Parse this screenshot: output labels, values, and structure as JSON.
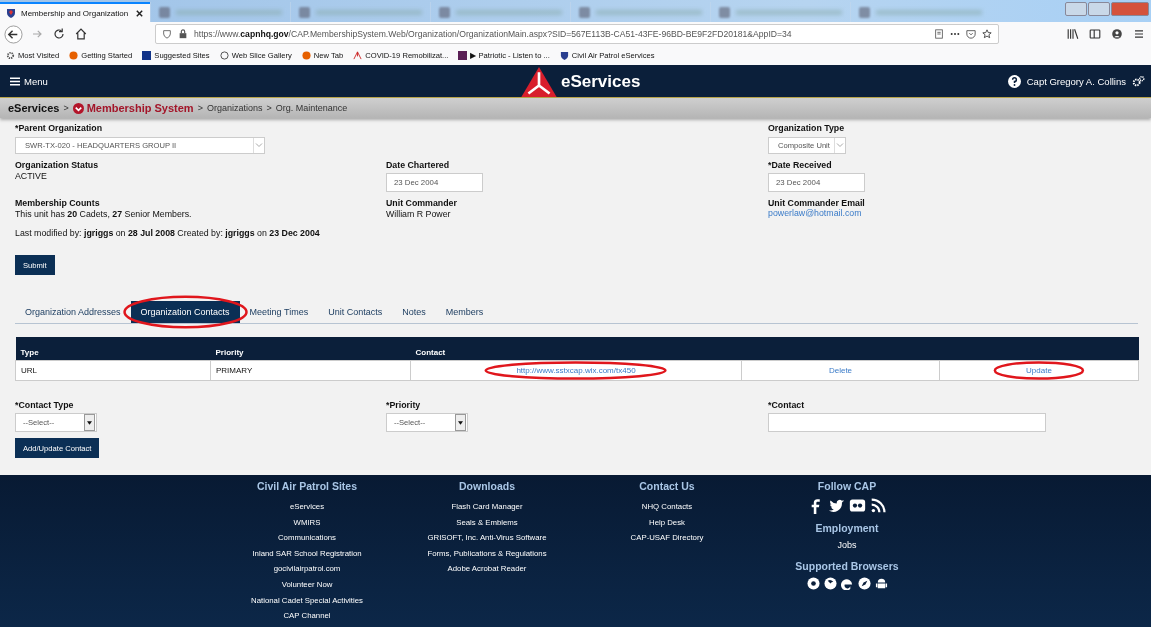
{
  "browser": {
    "tabs": [
      {
        "kind": "page",
        "title": "Membership and Organization",
        "selected": true
      },
      {
        "kind": "blurred",
        "selected": false
      },
      {
        "kind": "blurred",
        "selected": false
      },
      {
        "kind": "blurred",
        "selected": false
      },
      {
        "kind": "blurred",
        "selected": false
      },
      {
        "kind": "blurred",
        "selected": false
      },
      {
        "kind": "blurred",
        "selected": false
      }
    ],
    "url": "https://www.**capnhq.gov**/CAP.MembershipSystem.Web/Organization/OrganizationMain.aspx?SID=567E113B-CA51-43FE-96BD-BE9F2FD20181&AppID=34",
    "bookmarks": [
      {
        "kind": "gear",
        "label": "Most Visited"
      },
      {
        "kind": "firefox",
        "label": "Getting Started"
      },
      {
        "kind": "bing",
        "label": "Suggested Sites"
      },
      {
        "kind": "globe",
        "label": "Web Slice Gallery"
      },
      {
        "kind": "firefox",
        "label": "New Tab"
      },
      {
        "kind": "cap",
        "label": "COVID-19 Remobilizat..."
      },
      {
        "kind": "app",
        "label": "▶ Patriotic - Listen to ..."
      },
      {
        "kind": "shield",
        "label": "Civil Air Patrol eServices"
      }
    ]
  },
  "header": {
    "menu": "Menu",
    "title": "eServices",
    "user": "Capt Gregory A. Collins"
  },
  "breadcrumb": {
    "separator": ">",
    "items": [
      "eServices",
      "Membership System",
      "Organizations",
      "Org. Maintenance"
    ]
  },
  "form_rows": [
    {
      "left": {
        "kind": "select",
        "label": "*Parent Organization",
        "value": "SWR-TX-020 - HEADQUARTERS GROUP II"
      },
      "right": {
        "kind": "select",
        "label": "Organization Type",
        "value": "Composite Unit"
      }
    },
    {
      "left": {
        "kind": "text",
        "label": "Organization Status",
        "value": "ACTIVE"
      },
      "middle": {
        "kind": "input",
        "label": "Date Chartered",
        "value": "23 Dec 2004"
      },
      "right": {
        "kind": "input",
        "label": "*Date Received",
        "value": "23 Dec 2004"
      }
    },
    {
      "left": {
        "kind": "text",
        "label": "Membership Counts",
        "value": "This unit has **20** Cadets,  **27** Senior Members."
      },
      "middle": {
        "kind": "text",
        "label": "Unit Commander",
        "value": "William R Power"
      },
      "right": {
        "kind": "link",
        "label": "Unit Commander Email",
        "value": "powerlaw@hotmail.com"
      }
    }
  ],
  "modified": "Last modified by: **jgriggs** on **28 Jul 2008**    Created by: **jgriggs** on **23 Dec 2004**",
  "submit": "Submit",
  "tabs": [
    {
      "label": "Organization Addresses",
      "selected": false,
      "circled": false
    },
    {
      "label": "Organization Contacts",
      "selected": true,
      "circled": true
    },
    {
      "label": "Meeting Times",
      "selected": false,
      "circled": false
    },
    {
      "label": "Unit Contacts",
      "selected": false,
      "circled": false
    },
    {
      "label": "Notes",
      "selected": false,
      "circled": false
    },
    {
      "label": "Members",
      "selected": false,
      "circled": false
    }
  ],
  "table": {
    "columns": [
      "Type",
      "Priority",
      "Contact"
    ],
    "rows": [
      {
        "type": "URL",
        "priority": "PRIMARY",
        "contact": "http://www.sstxcap.wix.com/tx450",
        "contact_circled": true,
        "delete": "Delete",
        "update": "Update",
        "update_circled": true
      }
    ]
  },
  "contact_form": [
    {
      "kind": "select",
      "label": "*Contact Type",
      "value": "--Select--"
    },
    {
      "kind": "select",
      "label": "*Priority",
      "value": "--Select--"
    },
    {
      "kind": "input",
      "label": "*Contact"
    }
  ],
  "add_button": "Add/Update Contact",
  "footer": {
    "columns": [
      {
        "title": "Civil Air Patrol Sites",
        "links": [
          "eServices",
          "WMIRS",
          "Communications",
          "Inland SAR School Registration",
          "gocivilairpatrol.com",
          "Volunteer Now",
          "National Cadet Special Activities",
          "CAP Channel"
        ]
      },
      {
        "title": "Downloads",
        "links": [
          "Flash Card Manager",
          "Seals & Emblems",
          "GRISOFT, Inc. Anti-Virus Software",
          "Forms, Publications & Regulations",
          "Adobe Acrobat Reader"
        ]
      },
      {
        "title": "Contact Us",
        "links": [
          "NHQ Contacts",
          "Help Desk",
          "CAP-USAF Directory"
        ]
      }
    ],
    "follow": {
      "title": "Follow CAP",
      "icons": [
        {
          "kind": "facebook"
        },
        {
          "kind": "twitter"
        },
        {
          "kind": "flickr"
        },
        {
          "kind": "rss"
        }
      ]
    },
    "employment": {
      "title": "Employment",
      "links": [
        "Jobs"
      ]
    },
    "browsers": {
      "title": "Supported Browsers",
      "icons": [
        {
          "kind": "chrome"
        },
        {
          "kind": "firefox"
        },
        {
          "kind": "edge"
        },
        {
          "kind": "safari"
        },
        {
          "kind": "android"
        }
      ]
    }
  }
}
